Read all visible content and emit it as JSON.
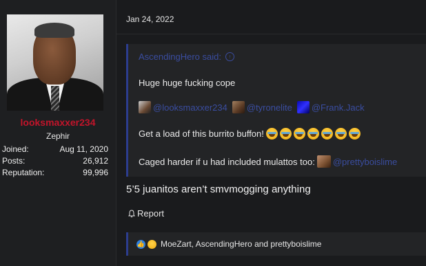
{
  "user": {
    "username": "looksmaxxer234",
    "title": "Zephir",
    "stats": [
      {
        "label": "Joined:",
        "value": "Aug 11, 2020"
      },
      {
        "label": "Posts:",
        "value": "26,912"
      },
      {
        "label": "Reputation:",
        "value": "99,996"
      }
    ]
  },
  "post": {
    "date": "Jan 24, 2022",
    "quote": {
      "author": "AscendingHero said:",
      "line1": "Huge huge fucking cope",
      "mentions": [
        "@looksmaxxer234",
        "@tyronelite",
        "@Frank.Jack"
      ],
      "line3": "Get a load of this burrito buffon!",
      "line4": "Caged harder if u had included mulattos too:",
      "line4_mention": "@prettyboislime"
    },
    "body": "5’5 juanitos aren’t smvmogging anything",
    "report_label": "Report",
    "reactions_text": "MoeZart, AscendingHero and prettyboislime"
  },
  "colors": {
    "username": "#c3142a",
    "mention": "#3a4da0",
    "quote_border": "#2c3d8f"
  },
  "icons": [
    "up-arrow-icon",
    "bell-icon",
    "like-icon",
    "haha-icon"
  ]
}
